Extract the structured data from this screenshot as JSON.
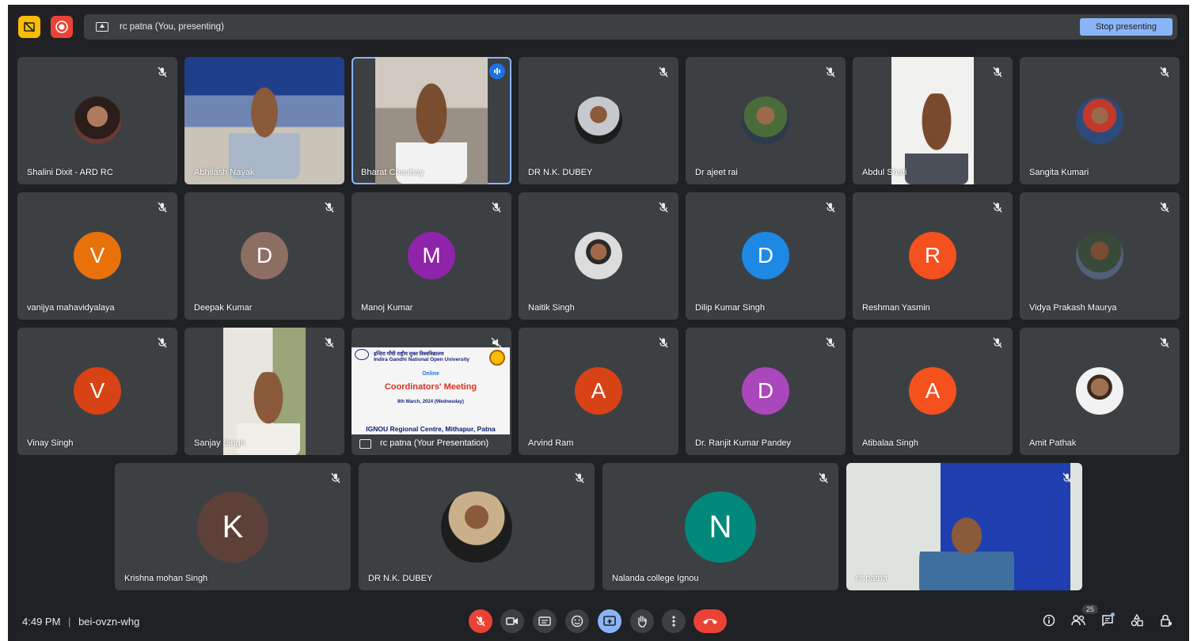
{
  "topbar": {
    "presenting_label": "rc patna (You, presenting)",
    "stop_label": "Stop presenting"
  },
  "colors": {
    "background": "#202124",
    "tile": "#3c4043",
    "accent": "#8ab4f8",
    "danger": "#ea4335",
    "warning": "#fbbc04"
  },
  "participants": [
    {
      "name": "Shalini Dixit - ARD RC"
    },
    {
      "name": "Abhilash Nayak"
    },
    {
      "name": "Bharat Chaubey"
    },
    {
      "name": "DR N.K. DUBEY"
    },
    {
      "name": "Dr ajeet rai"
    },
    {
      "name": "Abdul Shafi"
    },
    {
      "name": "Sangita Kumari"
    },
    {
      "name": "vanijya mahavidyalaya",
      "initial": "V"
    },
    {
      "name": "Deepak Kumar",
      "initial": "D"
    },
    {
      "name": "Manoj Kumar",
      "initial": "M"
    },
    {
      "name": "Naitik Singh"
    },
    {
      "name": "Dilip Kumar Singh",
      "initial": "D"
    },
    {
      "name": "Reshman Yasmin",
      "initial": "R"
    },
    {
      "name": "Vidya Prakash Maurya"
    },
    {
      "name": "Vinay Singh",
      "initial": "V"
    },
    {
      "name": "Sanjay Singh"
    },
    {
      "name": "Arvind Ram",
      "initial": "A"
    },
    {
      "name": "Dr. Ranjit Kumar Pandey",
      "initial": "D"
    },
    {
      "name": "Atibalaa Singh",
      "initial": "A"
    },
    {
      "name": "Amit Pathak"
    },
    {
      "name": "Krishna mohan Singh",
      "initial": "K"
    },
    {
      "name": "DR N.K. DUBEY"
    },
    {
      "name": "Nalanda college Ignou",
      "initial": "N"
    },
    {
      "name": "rc patna"
    }
  ],
  "presentation": {
    "label": "rc patna (Your Presentation)",
    "slide_header": "इन्दिरा गाँधी राष्ट्रीय मुक्त विश्वविद्यालय",
    "slide_university": "Indira Gandhi National Open University",
    "slide_online": "Online",
    "slide_title": "Coordinators' Meeting",
    "slide_date": "8th March, 2024 (Wednesday)",
    "slide_footer": "IGNOU Regional Centre, Mithapur, Patna"
  },
  "bottombar": {
    "time": "4:49 PM",
    "separator": "|",
    "meeting_code": "bei-ovzn-whg",
    "people_count": "25"
  }
}
